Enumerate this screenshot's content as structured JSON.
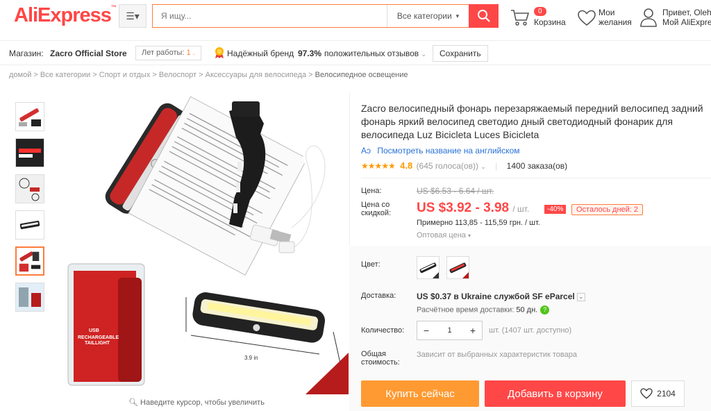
{
  "header": {
    "logo": "AliExpress",
    "search_placeholder": "Я ищу...",
    "category_select": "Все категории",
    "cart_count": "0",
    "cart_label": "Корзина",
    "wishlist_line1": "Мои",
    "wishlist_line2": "желания",
    "account_line1": "Привет, Oleh",
    "account_line2": "Мой AliExpress"
  },
  "store": {
    "shop_label": "Магазин:",
    "shop_name": "Zacro Official Store",
    "years_label": "Лет работы:",
    "years_value": "1 .",
    "trusted_label": "Надёжный бренд",
    "positive_percent": "97.3%",
    "positive_label": "положительных отзывов",
    "save_label": "Сохранить"
  },
  "breadcrumbs": [
    "домой",
    "Все категории",
    "Спорт и отдых",
    "Велоспорт",
    "Аксессуары для велосипеда",
    "Велосипедное освещение"
  ],
  "gallery": {
    "zoom_hint": "Наведите курсор, чтобы увеличить",
    "active_thumb_index": 4,
    "thumbnail_count": 6
  },
  "product": {
    "title": "Zacro велосипедный фонарь перезаряжаемый передний велосипед задний фонарь яркий велосипед светодио дный светодиодный фонарик для велосипеда Luz Bicicleta Luces Bicicleta",
    "translate_link": "Посмотреть название на английском",
    "rating_value": "4.8",
    "rating_votes": "(645 голоса(ов))",
    "orders": "1400 заказа(ов)",
    "price_label": "Цена:",
    "old_price": "US $6.53 - 6.64 / шт.",
    "discount_label_1": "Цена со",
    "discount_label_2": "скидкой:",
    "price": "US $3.92 - 3.98",
    "price_unit": "/ шт.",
    "discount": "-40%",
    "days_left": "Осталось дней: 2",
    "approx": "Примерно 113,85 - 115,59 грн. / шт.",
    "wholesale": "Оптовая цена",
    "color_label": "Цвет:",
    "delivery_label": "Доставка:",
    "shipping": "US $0.37 в Ukraine службой SF eParcel",
    "shipping_time_label": "Расчётное время доставки:",
    "shipping_time_value": "50 дн.",
    "quantity_label": "Количество:",
    "quantity_value": "1",
    "stock": "шт. (1407 шт. доступно)",
    "total_label_1": "Общая",
    "total_label_2": "стоимость:",
    "total_value": "Зависит от выбранных характеристик товара",
    "buy_now": "Купить сейчас",
    "add_to_cart": "Добавить в корзину",
    "wish_count": "2104"
  },
  "colors": {
    "brand_red": "#ff4747",
    "brand_orange": "#ff9a32",
    "link_blue": "#2972d6",
    "star": "#ff9a00"
  }
}
